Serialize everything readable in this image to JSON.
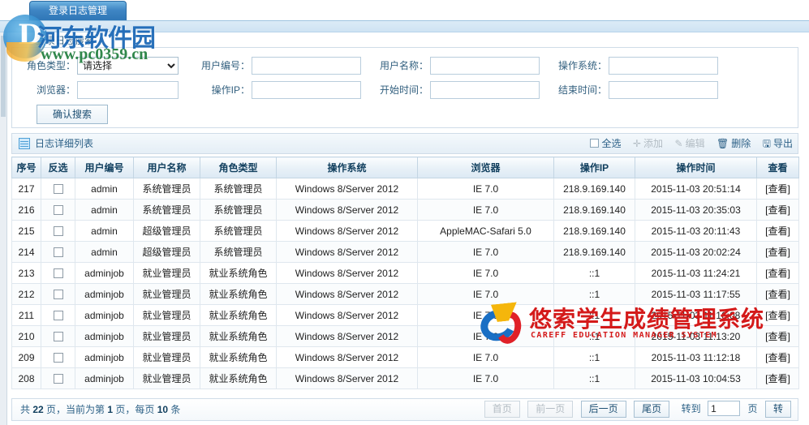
{
  "tab": {
    "label": "登录日志管理"
  },
  "search": {
    "title": "登录日志搜索",
    "fields": [
      {
        "label": "角色类型：",
        "type": "select",
        "value": "请选择",
        "name": "role-type"
      },
      {
        "label": "用户编号：",
        "type": "text",
        "value": "",
        "name": "user-id"
      },
      {
        "label": "用户名称：",
        "type": "text",
        "value": "",
        "name": "user-name"
      },
      {
        "label": "操作系统：",
        "type": "text",
        "value": "",
        "name": "os"
      },
      {
        "label": "浏览器：",
        "type": "text",
        "value": "",
        "name": "browser"
      },
      {
        "label": "操作IP：",
        "type": "text",
        "value": "",
        "name": "op-ip"
      },
      {
        "label": "开始时间：",
        "type": "text",
        "value": "",
        "name": "start-time"
      },
      {
        "label": "结束时间：",
        "type": "text",
        "value": "",
        "name": "end-time"
      }
    ],
    "submit_label": "确认搜索"
  },
  "list": {
    "title": "日志详细列表",
    "actions": [
      {
        "label": "全选",
        "icon": "checkbox-icon",
        "disabled": false
      },
      {
        "label": "添加",
        "icon": "plus-icon",
        "disabled": true
      },
      {
        "label": "编辑",
        "icon": "pencil-icon",
        "disabled": true
      },
      {
        "label": "删除",
        "icon": "trash-icon",
        "disabled": false
      },
      {
        "label": "导出",
        "icon": "export-icon",
        "disabled": false
      }
    ],
    "columns": [
      "序号",
      "反选",
      "用户编号",
      "用户名称",
      "角色类型",
      "操作系统",
      "浏览器",
      "操作IP",
      "操作时间",
      "查看"
    ],
    "view_label": "[查看]",
    "rows": [
      {
        "id": "217",
        "user_id": "admin",
        "user_name": "系统管理员",
        "role": "系统管理员",
        "os": "Windows 8/Server 2012",
        "browser": "IE 7.0",
        "ip": "218.9.169.140",
        "time": "2015-11-03 20:51:14"
      },
      {
        "id": "216",
        "user_id": "admin",
        "user_name": "系统管理员",
        "role": "系统管理员",
        "os": "Windows 8/Server 2012",
        "browser": "IE 7.0",
        "ip": "218.9.169.140",
        "time": "2015-11-03 20:35:03"
      },
      {
        "id": "215",
        "user_id": "admin",
        "user_name": "超级管理员",
        "role": "系统管理员",
        "os": "Windows 8/Server 2012",
        "browser": "AppleMAC-Safari 5.0",
        "ip": "218.9.169.140",
        "time": "2015-11-03 20:11:43"
      },
      {
        "id": "214",
        "user_id": "admin",
        "user_name": "超级管理员",
        "role": "系统管理员",
        "os": "Windows 8/Server 2012",
        "browser": "IE 7.0",
        "ip": "218.9.169.140",
        "time": "2015-11-03 20:02:24"
      },
      {
        "id": "213",
        "user_id": "adminjob",
        "user_name": "就业管理员",
        "role": "就业系统角色",
        "os": "Windows 8/Server 2012",
        "browser": "IE 7.0",
        "ip": "::1",
        "time": "2015-11-03 11:24:21"
      },
      {
        "id": "212",
        "user_id": "adminjob",
        "user_name": "就业管理员",
        "role": "就业系统角色",
        "os": "Windows 8/Server 2012",
        "browser": "IE 7.0",
        "ip": "::1",
        "time": "2015-11-03 11:17:55"
      },
      {
        "id": "211",
        "user_id": "adminjob",
        "user_name": "就业管理员",
        "role": "就业系统角色",
        "os": "Windows 8/Server 2012",
        "browser": "IE 7.0",
        "ip": "::1",
        "time": "2015-11-03 11:16:08"
      },
      {
        "id": "210",
        "user_id": "adminjob",
        "user_name": "就业管理员",
        "role": "就业系统角色",
        "os": "Windows 8/Server 2012",
        "browser": "IE 7.0",
        "ip": "::1",
        "time": "2015-11-03 11:13:20"
      },
      {
        "id": "209",
        "user_id": "adminjob",
        "user_name": "就业管理员",
        "role": "就业系统角色",
        "os": "Windows 8/Server 2012",
        "browser": "IE 7.0",
        "ip": "::1",
        "time": "2015-11-03 11:12:18"
      },
      {
        "id": "208",
        "user_id": "adminjob",
        "user_name": "就业管理员",
        "role": "就业系统角色",
        "os": "Windows 8/Server 2012",
        "browser": "IE 7.0",
        "ip": "::1",
        "time": "2015-11-03 10:04:53"
      }
    ]
  },
  "footer": {
    "info_prefix": "共 ",
    "total_pages": "22",
    "info_mid1": " 页，当前为第 ",
    "current_page": "1",
    "info_mid2": " 页，每页 ",
    "page_size": "10",
    "info_suffix": " 条",
    "pager": {
      "first": "首页",
      "prev": "前一页",
      "next": "后一页",
      "last": "尾页",
      "goto_label": "转到",
      "goto_value": "1",
      "page_unit": "页",
      "go": "转"
    }
  },
  "watermarks": {
    "top_left_text": "河东软件园",
    "top_left_url": "www.pc0359.cn",
    "top_left_logo": "D",
    "center_cn": "悠索学生成绩管理系统",
    "center_en": "CAREFF EDUCATION MANAGER SYSTEM"
  },
  "colors": {
    "tab_blue": "#2f76b6",
    "header_text": "#12405f",
    "label_text": "#33607f",
    "wm_blue": "#1765b5",
    "wm_green": "#1f7d3c",
    "wm_red": "#d41a1a"
  }
}
